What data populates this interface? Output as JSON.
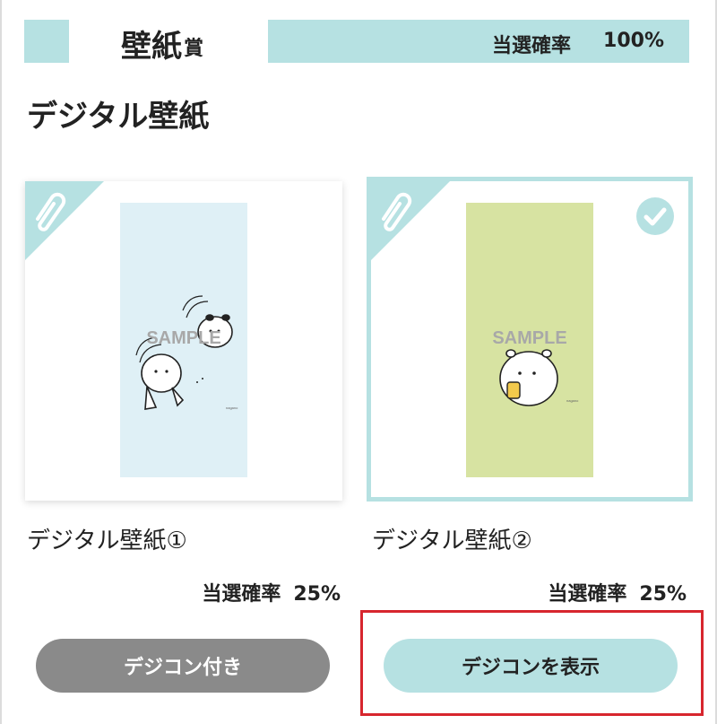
{
  "banner": {
    "title": "壁紙",
    "title_suffix": "賞",
    "rate_label": "当選確率",
    "rate_value": "100%"
  },
  "section_title": "デジタル壁紙",
  "items": [
    {
      "name": "デジタル壁紙①",
      "rate_label": "当選確率",
      "rate_value": "25%",
      "sample_text": "SAMPLE",
      "selected": false,
      "wallpaper_color": "#dff0f6"
    },
    {
      "name": "デジタル壁紙②",
      "rate_label": "当選確率",
      "rate_value": "25%",
      "sample_text": "SAMPLE",
      "selected": true,
      "wallpaper_color": "#d7e3a2"
    }
  ],
  "buttons": {
    "decocon_attached": "デジコン付き",
    "show_decocon": "デジコンを表示"
  },
  "colors": {
    "accent": "#b6e1e2",
    "gray_button": "#8a8a8a",
    "highlight": "#d7262e"
  },
  "icons": {
    "corner": "paperclip-icon",
    "selected": "check-icon"
  }
}
